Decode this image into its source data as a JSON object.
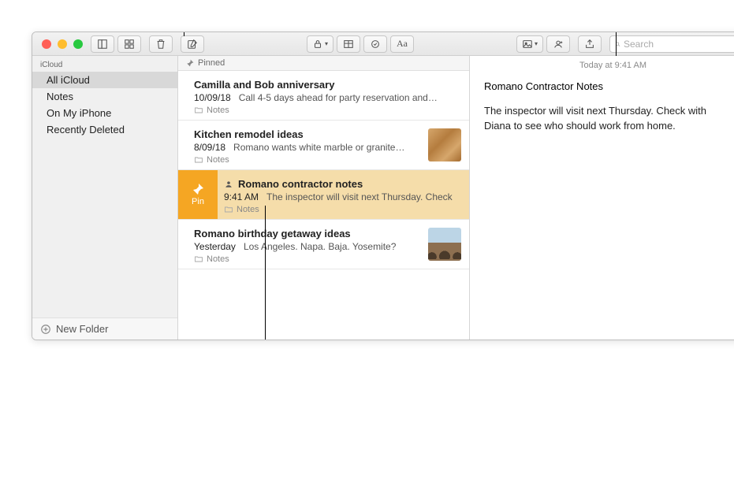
{
  "toolbar": {
    "search_placeholder": "Search"
  },
  "sidebar": {
    "section_label": "iCloud",
    "items": [
      {
        "label": "All iCloud",
        "selected": true
      },
      {
        "label": "Notes",
        "selected": false
      },
      {
        "label": "On My iPhone",
        "selected": false
      },
      {
        "label": "Recently Deleted",
        "selected": false
      }
    ],
    "new_folder_label": "New Folder"
  },
  "list": {
    "section_header": "Pinned",
    "pin_gutter_label": "Pin",
    "notes": [
      {
        "title": "Camilla and Bob anniversary",
        "date": "10/09/18",
        "snippet": "Call 4-5 days ahead for party reservation and…",
        "folder": "Notes",
        "thumb": "none",
        "shared": false,
        "selected": false,
        "show_pin": false
      },
      {
        "title": "Kitchen remodel ideas",
        "date": "8/09/18",
        "snippet": "Romano wants white marble or granite…",
        "folder": "Notes",
        "thumb": "wood",
        "shared": false,
        "selected": false,
        "show_pin": false
      },
      {
        "title": "Romano contractor notes",
        "date": "9:41 AM",
        "snippet": "The inspector will visit next Thursday. Check",
        "folder": "Notes",
        "thumb": "none",
        "shared": true,
        "selected": true,
        "show_pin": true
      },
      {
        "title": "Romano birthday getaway ideas",
        "date": "Yesterday",
        "snippet": "Los Angeles. Napa. Baja. Yosemite?",
        "folder": "Notes",
        "thumb": "beach",
        "shared": false,
        "selected": false,
        "show_pin": false
      }
    ]
  },
  "editor": {
    "date_line": "Today at 9:41 AM",
    "title": "Romano Contractor Notes",
    "body": "The inspector will visit next Thursday. Check with Diana to see who should work from home."
  }
}
